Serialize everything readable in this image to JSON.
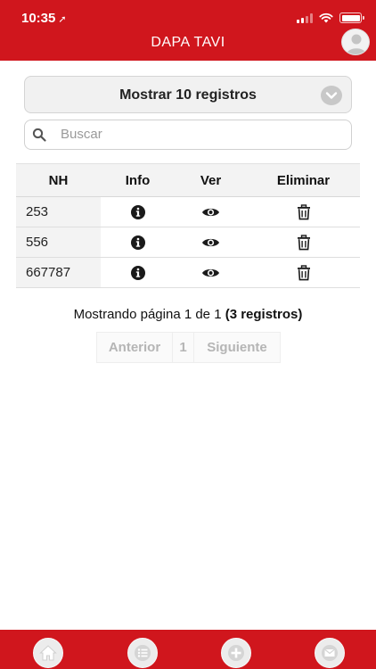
{
  "status_bar": {
    "time": "10:35"
  },
  "header": {
    "title": "DAPA TAVI"
  },
  "length_select": {
    "label": "Mostrar 10 registros"
  },
  "search": {
    "placeholder": "Buscar",
    "value": ""
  },
  "table": {
    "columns": [
      "NH",
      "Info",
      "Ver",
      "Eliminar"
    ],
    "rows": [
      {
        "nh": "253"
      },
      {
        "nh": "556"
      },
      {
        "nh": "667787"
      }
    ]
  },
  "pagination": {
    "info_prefix": "Mostrando página 1 de 1",
    "info_count": "(3 registros)",
    "prev_label": "Anterior",
    "current_page": "1",
    "next_label": "Siguiente"
  },
  "colors": {
    "brand_red": "#d0161d",
    "header_gray": "#f3f3f3",
    "disabled_text": "#b5b5b5"
  },
  "icons": {
    "info": "info-circle-icon",
    "view": "eye-icon",
    "delete": "trash-icon",
    "tabs": [
      "home-icon",
      "list-icon",
      "plus-icon",
      "mail-icon"
    ]
  }
}
